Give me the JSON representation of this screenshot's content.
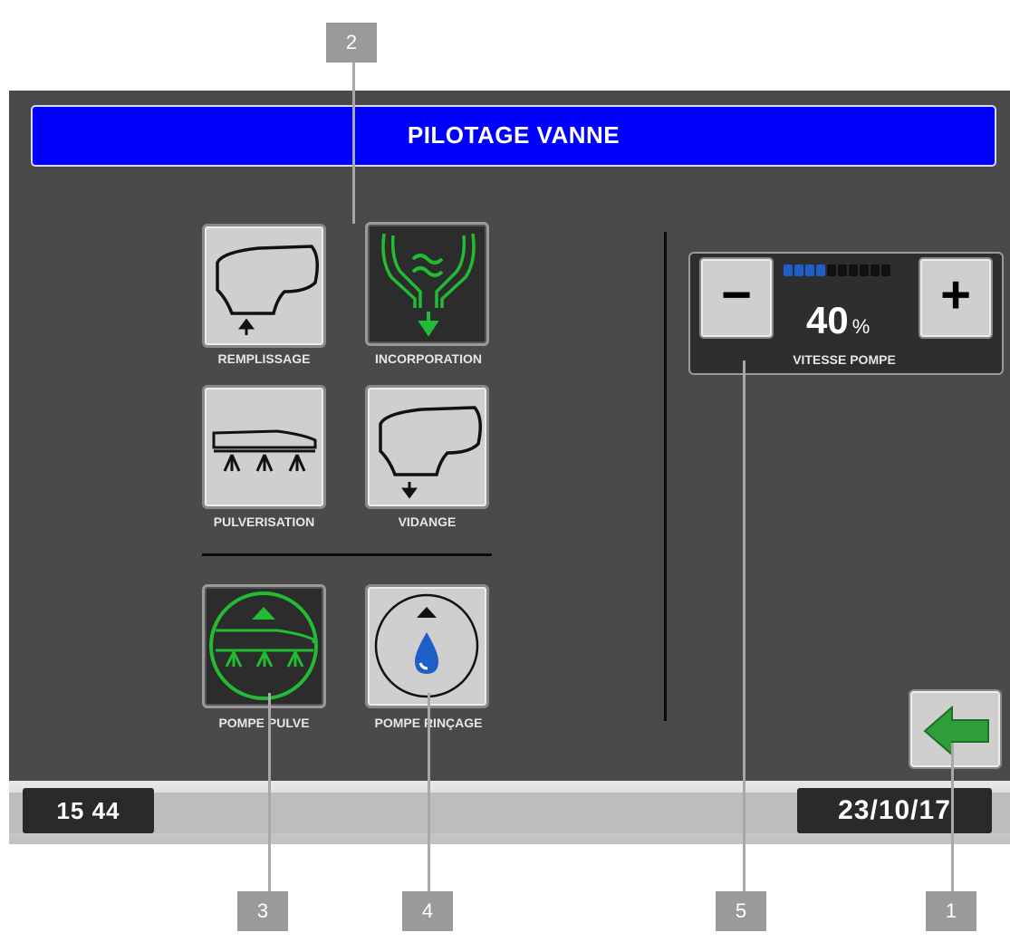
{
  "header": {
    "title": "PILOTAGE VANNE"
  },
  "valves": [
    {
      "label": "REMPLISSAGE",
      "icon": "tank-fill-icon",
      "active": false
    },
    {
      "label": "INCORPORATION",
      "icon": "hopper-incorporation-icon",
      "active": true
    },
    {
      "label": "PULVERISATION",
      "icon": "boom-spray-icon",
      "active": false
    },
    {
      "label": "VIDANGE",
      "icon": "tank-drain-icon",
      "active": false
    }
  ],
  "pumps": [
    {
      "label": "POMPE PULVE",
      "icon": "spray-pump-icon",
      "active": true
    },
    {
      "label": "POMPE RINÇAGE",
      "icon": "rinse-pump-icon",
      "active": false
    }
  ],
  "pump_speed": {
    "label": "VITESSE POMPE",
    "value": "40",
    "unit": "%",
    "level_fraction": 0.4,
    "segments_total": 10,
    "segments_on": 4,
    "minus_label": "−",
    "plus_label": "+"
  },
  "back_button": {
    "icon": "back-arrow-icon"
  },
  "status": {
    "time": "15 44",
    "date": "23/10/17"
  },
  "callouts": [
    "2",
    "3",
    "4",
    "5",
    "1"
  ],
  "colors": {
    "title_bar": "#0000ff",
    "active_green": "#22bb33",
    "level_blue": "#1e5ec8",
    "screen_bg": "#4a4a4a",
    "tile_bg": "#cfcfcf"
  }
}
